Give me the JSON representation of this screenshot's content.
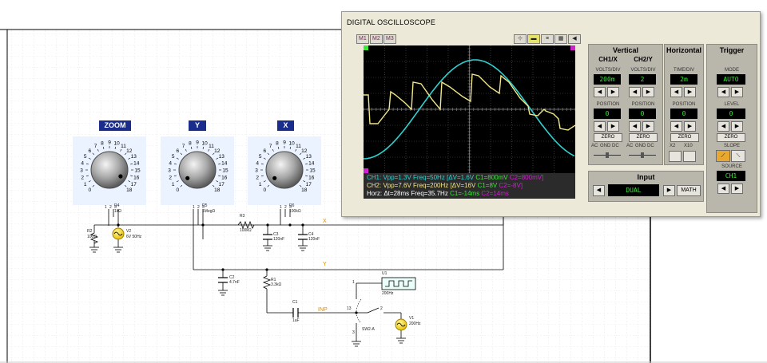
{
  "oscilloscope": {
    "title": "DIGITAL OSCILLOSCOPE",
    "memory_buttons": [
      "M1",
      "M2",
      "M3"
    ],
    "vertical": {
      "title": "Vertical",
      "ch1_label": "CH1/X",
      "ch2_label": "CH2/Y",
      "volts_div_label": "VOLTS/DIV",
      "ch1_volts_div": "200m",
      "ch2_volts_div": "2",
      "position_label": "POSITION",
      "ch1_position": "0",
      "ch2_position": "0",
      "zero_label": "ZERO",
      "coupling": [
        "AC",
        "GND",
        "DC"
      ]
    },
    "horizontal": {
      "title": "Horizontal",
      "time_div_label": "TIME/DIV",
      "time_div": "2m",
      "position_label": "POSITION",
      "position": "0",
      "zero_label": "ZERO",
      "x2_label": "X2",
      "x10_label": "X10"
    },
    "trigger": {
      "title": "Trigger",
      "mode_label": "MODE",
      "mode": "AUTO",
      "level_label": "LEVEL",
      "level": "0",
      "zero_label": "ZERO",
      "slope_label": "SLOPE",
      "source_label": "SOURCE",
      "source": "CH1"
    },
    "input": {
      "title": "Input",
      "mode": "DUAL",
      "math_label": "MATH"
    },
    "readout": {
      "ch1": {
        "text": "CH1: Vpp=1.3V Freq=50Hz",
        "delta": "[ΔV=1.6V",
        "c1": "C1=800mV",
        "c2": "C2=800mV]"
      },
      "ch2": {
        "text": "CH2: Vpp=7.6V Freq=200Hz",
        "delta": "[ΔV=16V",
        "c1": "C1=8V",
        "c2": "C2=-8V]"
      },
      "horz": {
        "text": "Horz: Δt=28ms  Freq=35.7Hz",
        "c1": "C1=-14ms",
        "c2": "C2=14ms"
      }
    },
    "colors": {
      "ch1": "#f0e68c",
      "ch2": "#30d0d0",
      "cursor1": "#39e639",
      "cursor2": "#d020d0"
    }
  },
  "knobs": [
    {
      "title": "ZOOM",
      "name": "R4",
      "value": "1kΩ"
    },
    {
      "title": "Y",
      "name": "R5",
      "value": "1MegΩ"
    },
    {
      "title": "X",
      "name": "R6",
      "value": "100kΩ"
    }
  ],
  "dial_numbers": [
    "0",
    "1",
    "2",
    "3",
    "4",
    "5",
    "6",
    "7",
    "8",
    "9",
    "10",
    "11",
    "12",
    "13",
    "14",
    "15",
    "16",
    "17",
    "18"
  ],
  "dial_marks": {
    "tilde": "~",
    "plus": "+"
  },
  "components": {
    "r2": {
      "name": "R2",
      "value": "100Ω"
    },
    "v2": {
      "name": "V2",
      "value": "6V 50Hz"
    },
    "r3": {
      "name": "R3",
      "value": "100kΩ"
    },
    "c3": {
      "name": "C3",
      "value": "120nF"
    },
    "c4": {
      "name": "C4",
      "value": "120nF"
    },
    "c2": {
      "name": "C2",
      "value": "4.7nF"
    },
    "r1": {
      "name": "R1",
      "value": "3.3kΩ"
    },
    "c1": {
      "name": "C1",
      "value": "1uF"
    },
    "u1": {
      "name": "U1",
      "value": "200Hz"
    },
    "v1": {
      "name": "V1",
      "value": "200Hz"
    },
    "sw": {
      "name": "SW2-A"
    }
  },
  "net_labels": {
    "x": "X",
    "y": "Y",
    "inp": "INP"
  },
  "pin_labels": {
    "p1": "1",
    "p2": "2",
    "p3": "3",
    "p13": "13"
  }
}
